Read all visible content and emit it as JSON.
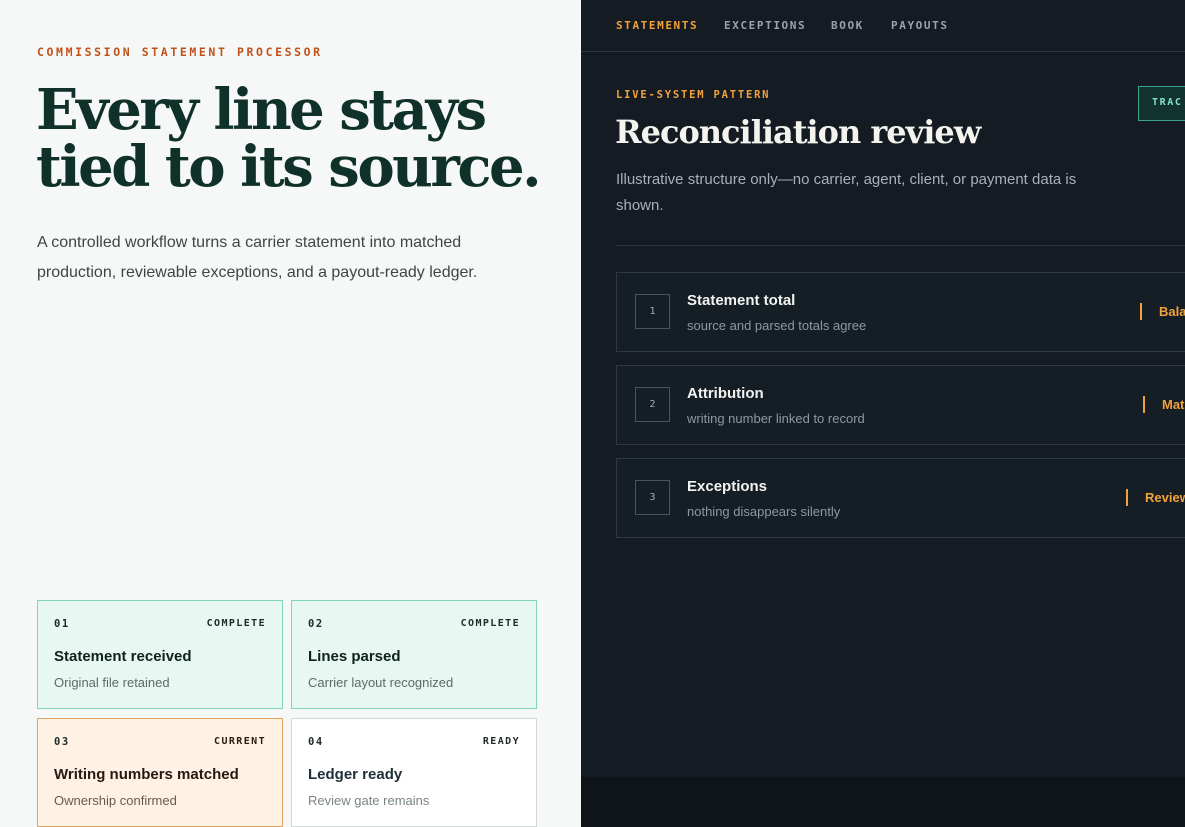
{
  "hero": {
    "eyebrow": "COMMISSION STATEMENT PROCESSOR",
    "headline_line1": "Every line stays",
    "headline_line2": "tied to its source.",
    "lede": "A controlled workflow turns a carrier statement into matched production, reviewable exceptions, and a payout-ready ledger."
  },
  "steps": [
    {
      "num": "01",
      "status": "COMPLETE",
      "title": "Statement received",
      "sub": "Original file retained"
    },
    {
      "num": "02",
      "status": "COMPLETE",
      "title": "Lines parsed",
      "sub": "Carrier layout recognized"
    },
    {
      "num": "03",
      "status": "CURRENT",
      "title": "Writing numbers matched",
      "sub": "Ownership confirmed"
    },
    {
      "num": "04",
      "status": "READY",
      "title": "Ledger ready",
      "sub": "Review gate remains"
    }
  ],
  "nav": [
    "STATEMENTS",
    "EXCEPTIONS",
    "BOOK",
    "PAYOUTS"
  ],
  "review": {
    "pattern": "LIVE-SYSTEM PATTERN",
    "track_button": "TRAC",
    "title": "Reconciliation review",
    "description": "Illustrative structure only—no carrier, agent, client, or payment data is shown.",
    "rows": [
      {
        "step": "1",
        "label": "Statement total",
        "desc": "source and parsed totals agree",
        "badge": "Bala"
      },
      {
        "step": "2",
        "label": "Attribution",
        "desc": "writing number linked to record",
        "badge": "Mat"
      },
      {
        "step": "3",
        "label": "Exceptions",
        "desc": "nothing disappears silently",
        "badge": "Review"
      }
    ]
  },
  "colors": {
    "accent_orange": "#f2a23a",
    "eyebrow_rust": "#c0521c",
    "complete_bg": "#e6f8f1",
    "current_bg": "#fdf2e4",
    "dark_panel": "#141b22"
  }
}
